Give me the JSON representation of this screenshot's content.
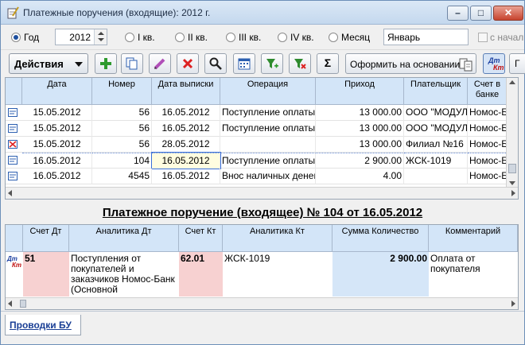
{
  "window": {
    "title": "Платежные поручения (входящие): 2012 г."
  },
  "period": {
    "year_label": "Год",
    "year_value": "2012",
    "q1": "I кв.",
    "q2": "II кв.",
    "q3": "III кв.",
    "q4": "IV кв.",
    "month_label": "Месяц",
    "month_value": "Январь",
    "from_start_label": "с начал"
  },
  "toolbar": {
    "actions_label": "Действия",
    "create_basis_label": "Оформить на основании",
    "sum_label": "Σ",
    "dt_label": "Дт",
    "kt_label": "Кт",
    "extra_label": "Г"
  },
  "top_table": {
    "columns": [
      "Дата",
      "Номер",
      "Дата выписки",
      "Операция",
      "Приход",
      "Плательщик",
      "Счет в банке"
    ],
    "rows": [
      {
        "date": "15.05.2012",
        "num": "56",
        "date_out": "16.05.2012",
        "op": "Поступление оплаты",
        "income": "13 000.00",
        "payer": "ООО \"МОДУЛЬ",
        "bank": "Номос-Б"
      },
      {
        "date": "15.05.2012",
        "num": "56",
        "date_out": "16.05.2012",
        "op": "Поступление оплаты",
        "income": "13 000.00",
        "payer": "ООО \"МОДУЛЬ",
        "bank": "Номос-Б"
      },
      {
        "date": "15.05.2012",
        "num": "56",
        "date_out": "28.05.2012",
        "op": "",
        "income": "13 000.00",
        "payer": "Филиал №16",
        "bank": "Номос-Б"
      },
      {
        "date": "16.05.2012",
        "num": "104",
        "date_out": "16.05.2012",
        "op": "Поступление оплаты",
        "income": "2 900.00",
        "payer": "ЖСК-1019",
        "bank": "Номос-Б"
      },
      {
        "date": "16.05.2012",
        "num": "4545",
        "date_out": "16.05.2012",
        "op": "Внос наличных денег",
        "income": "4.00",
        "payer": "",
        "bank": "Номос-Б"
      }
    ]
  },
  "document": {
    "heading": "Платежное поручение (входящее) № 104 от 16.05.2012"
  },
  "bottom_table": {
    "columns": [
      "Счет Дт",
      "Аналитика Дт",
      "Счет Кт",
      "Аналитика Кт",
      "Сумма Количество",
      "Комментарий"
    ],
    "row": {
      "acc_dt": "51",
      "an_dt": "Поступления от покупателей и заказчиков Номос-Банк (Основной",
      "acc_kt": "62.01",
      "an_kt": "ЖСК-1019",
      "sum": "2 900.00",
      "comment": "Оплата от покупателя"
    }
  },
  "tabs": {
    "postings": "Проводки БУ"
  }
}
